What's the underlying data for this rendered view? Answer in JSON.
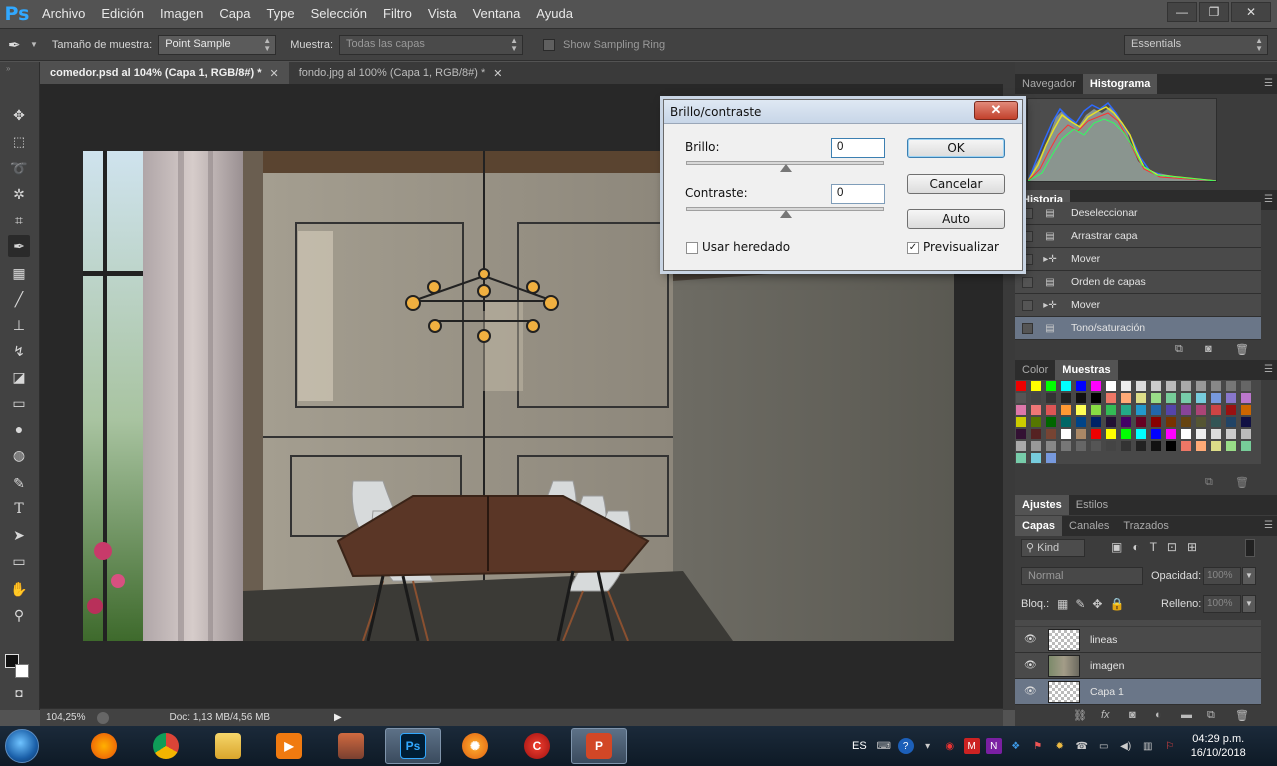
{
  "app": {
    "logo": "Ps",
    "menu": [
      "Archivo",
      "Edición",
      "Imagen",
      "Capa",
      "Type",
      "Selección",
      "Filtro",
      "Vista",
      "Ventana",
      "Ayuda"
    ],
    "window_controls": [
      "—",
      "❐",
      "✕"
    ]
  },
  "options_bar": {
    "sample_size_label": "Tamaño de muestra:",
    "sample_size_value": "Point Sample",
    "sample_label": "Muestra:",
    "sample_value": "Todas las capas",
    "sampling_ring_label": "Show Sampling Ring",
    "workspace": "Essentials"
  },
  "tabs": [
    {
      "label": "comedor.psd al 104% (Capa 1, RGB/8#) *",
      "active": true
    },
    {
      "label": "fondo.jpg al 100% (Capa 1, RGB/8#) *",
      "active": false
    }
  ],
  "status": {
    "zoom": "104,25%",
    "doc": "Doc: 1,13 MB/4,56 MB"
  },
  "dialog": {
    "title": "Brillo/contraste",
    "brightness_label": "Brillo:",
    "brightness_value": "0",
    "contrast_label": "Contraste:",
    "contrast_value": "0",
    "legacy_label": "Usar heredado",
    "preview_label": "Previsualizar",
    "preview_checked": true,
    "legacy_checked": false,
    "ok": "OK",
    "cancel": "Cancelar",
    "auto": "Auto"
  },
  "panels": {
    "navigator_tab": "Navegador",
    "histogram_tab": "Histograma",
    "history_tab": "Historia",
    "history_items": [
      {
        "label": "Deseleccionar",
        "icon": "doc-icon"
      },
      {
        "label": "Arrastrar capa",
        "icon": "doc-icon"
      },
      {
        "label": "Mover",
        "icon": "move-icon"
      },
      {
        "label": "Orden de capas",
        "icon": "doc-icon"
      },
      {
        "label": "Mover",
        "icon": "move-icon"
      },
      {
        "label": "Tono/saturación",
        "icon": "doc-icon"
      }
    ],
    "color_tab": "Color",
    "swatches_tab": "Muestras",
    "adjustments_tab": "Ajustes",
    "styles_tab": "Estilos",
    "layers_tab": "Capas",
    "channels_tab": "Canales",
    "paths_tab": "Trazados",
    "kind_label": "Kind",
    "blend_mode": "Normal",
    "opacity_label": "Opacidad:",
    "opacity_value": "100%",
    "lock_label": "Bloq.:",
    "fill_label": "Relleno:",
    "fill_value": "100%",
    "layers": [
      {
        "name": "lineas",
        "thumb": "checker",
        "selected": false
      },
      {
        "name": "imagen",
        "thumb": "photo",
        "selected": false
      },
      {
        "name": "Capa 1",
        "thumb": "photo-checker",
        "selected": true
      }
    ]
  },
  "taskbar": {
    "lang": "ES",
    "time": "04:29 p.m.",
    "date": "16/10/2018",
    "apps": [
      "firefox-icon",
      "chrome-icon",
      "explorer-icon",
      "media-player-icon",
      "network-icon",
      "photoshop-icon",
      "vlc-like-icon",
      "ccleaner-icon",
      "powerpoint-icon"
    ]
  },
  "colors": {
    "ps_blue": "#31a8ff",
    "panel_bg": "#3c3c3c",
    "selected_row": "#6a7688"
  }
}
